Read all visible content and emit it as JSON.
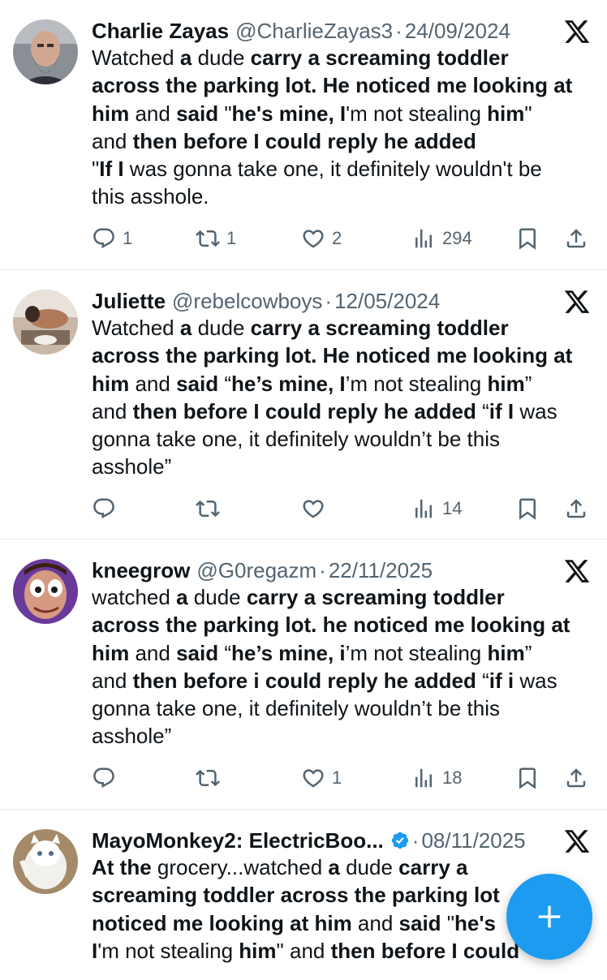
{
  "tweets": [
    {
      "name": "Charlie Zayas",
      "handle": "@CharlieZayas3",
      "sep": "·",
      "date": "24/09/2024",
      "lines": [
        [
          {
            "t": "Watched ",
            "b": false
          },
          {
            "t": "a",
            "b": true
          },
          {
            "t": " dude ",
            "b": false
          },
          {
            "t": "carry a screaming toddler",
            "b": true
          }
        ],
        [
          {
            "t": "across the parking lot. He noticed me looking at",
            "b": true
          }
        ],
        [
          {
            "t": "him",
            "b": true
          },
          {
            "t": " and ",
            "b": false
          },
          {
            "t": "said",
            "b": true
          },
          {
            "t": " \"",
            "b": false
          },
          {
            "t": "he's mine, I",
            "b": true
          },
          {
            "t": "'m not stealing ",
            "b": false
          },
          {
            "t": "him",
            "b": true
          },
          {
            "t": "\"",
            "b": false
          }
        ],
        [
          {
            "t": "and ",
            "b": false
          },
          {
            "t": "then before I could reply he added",
            "b": true
          }
        ],
        [
          {
            "t": "\"",
            "b": false
          },
          {
            "t": "If I",
            "b": true
          },
          {
            "t": " was gonna take one, it definitely wouldn't be",
            "b": false
          }
        ],
        [
          {
            "t": "this asshole.",
            "b": false
          }
        ]
      ],
      "replies": "1",
      "reposts": "1",
      "likes": "2",
      "views": "294"
    },
    {
      "name": "Juliette",
      "handle": "@rebelcowboys",
      "sep": "·",
      "date": "12/05/2024",
      "lines": [
        [
          {
            "t": "Watched ",
            "b": false
          },
          {
            "t": "a",
            "b": true
          },
          {
            "t": " dude ",
            "b": false
          },
          {
            "t": "carry a screaming toddler",
            "b": true
          }
        ],
        [
          {
            "t": "across the parking lot. He noticed me looking at",
            "b": true
          }
        ],
        [
          {
            "t": "him",
            "b": true
          },
          {
            "t": " and ",
            "b": false
          },
          {
            "t": "said",
            "b": true
          },
          {
            "t": " “",
            "b": false
          },
          {
            "t": "he’s mine, I",
            "b": true
          },
          {
            "t": "’m not stealing ",
            "b": false
          },
          {
            "t": "him",
            "b": true
          },
          {
            "t": "”",
            "b": false
          }
        ],
        [
          {
            "t": "and ",
            "b": false
          },
          {
            "t": "then before I could reply he added",
            "b": true
          },
          {
            "t": " “",
            "b": false
          },
          {
            "t": "if I",
            "b": true
          },
          {
            "t": " was",
            "b": false
          }
        ],
        [
          {
            "t": "gonna take one, it definitely wouldn’t be this",
            "b": false
          }
        ],
        [
          {
            "t": "asshole”",
            "b": false
          }
        ]
      ],
      "replies": "",
      "reposts": "",
      "likes": "",
      "views": "14"
    },
    {
      "name": "kneegrow",
      "handle": "@G0regazm",
      "sep": "·",
      "date": "22/11/2025",
      "lines": [
        [
          {
            "t": "watched ",
            "b": false
          },
          {
            "t": "a",
            "b": true
          },
          {
            "t": " dude ",
            "b": false
          },
          {
            "t": "carry a screaming toddler",
            "b": true
          }
        ],
        [
          {
            "t": "across the parking lot. he noticed me looking at",
            "b": true
          }
        ],
        [
          {
            "t": "him",
            "b": true
          },
          {
            "t": " and ",
            "b": false
          },
          {
            "t": "said",
            "b": true
          },
          {
            "t": " “",
            "b": false
          },
          {
            "t": "he’s mine, i",
            "b": true
          },
          {
            "t": "’m not stealing ",
            "b": false
          },
          {
            "t": "him",
            "b": true
          },
          {
            "t": "”",
            "b": false
          }
        ],
        [
          {
            "t": "and ",
            "b": false
          },
          {
            "t": "then before i could reply he added",
            "b": true
          },
          {
            "t": " “",
            "b": false
          },
          {
            "t": "if i",
            "b": true
          },
          {
            "t": " was",
            "b": false
          }
        ],
        [
          {
            "t": "gonna take one, it definitely wouldn’t be this",
            "b": false
          }
        ],
        [
          {
            "t": "asshole”",
            "b": false
          }
        ]
      ],
      "replies": "",
      "reposts": "",
      "likes": "1",
      "views": "18"
    },
    {
      "name": "MayoMonkey2: ElectricBoo...",
      "handle": "",
      "sep": "·",
      "date": "08/11/2025",
      "verified": true,
      "lines": [
        [
          {
            "t": "At the",
            "b": true
          },
          {
            "t": " grocery...watched ",
            "b": false
          },
          {
            "t": "a",
            "b": true
          },
          {
            "t": " dude ",
            "b": false
          },
          {
            "t": "carry a",
            "b": true
          }
        ],
        [
          {
            "t": "screaming toddler across the parking lot",
            "b": true
          }
        ],
        [
          {
            "t": "noticed me looking at him",
            "b": true
          },
          {
            "t": " and ",
            "b": false
          },
          {
            "t": "said",
            "b": true
          },
          {
            "t": " \"",
            "b": false
          },
          {
            "t": "he's",
            "b": true
          }
        ],
        [
          {
            "t": "I",
            "b": true
          },
          {
            "t": "'m not stealing ",
            "b": false
          },
          {
            "t": "him",
            "b": true
          },
          {
            "t": "\" and ",
            "b": false
          },
          {
            "t": "then before I could",
            "b": true
          }
        ]
      ]
    }
  ],
  "icons": {
    "x_logo": "x-logo-icon",
    "reply": "reply-icon",
    "repost": "repost-icon",
    "like": "heart-icon",
    "views": "views-icon",
    "bookmark": "bookmark-icon",
    "share": "share-icon",
    "compose": "plus-icon",
    "verified": "verified-badge-icon"
  },
  "colors": {
    "text": "#0f1419",
    "secondary": "#536471",
    "accent": "#1d9bf0",
    "divider": "#e6e9ec"
  }
}
